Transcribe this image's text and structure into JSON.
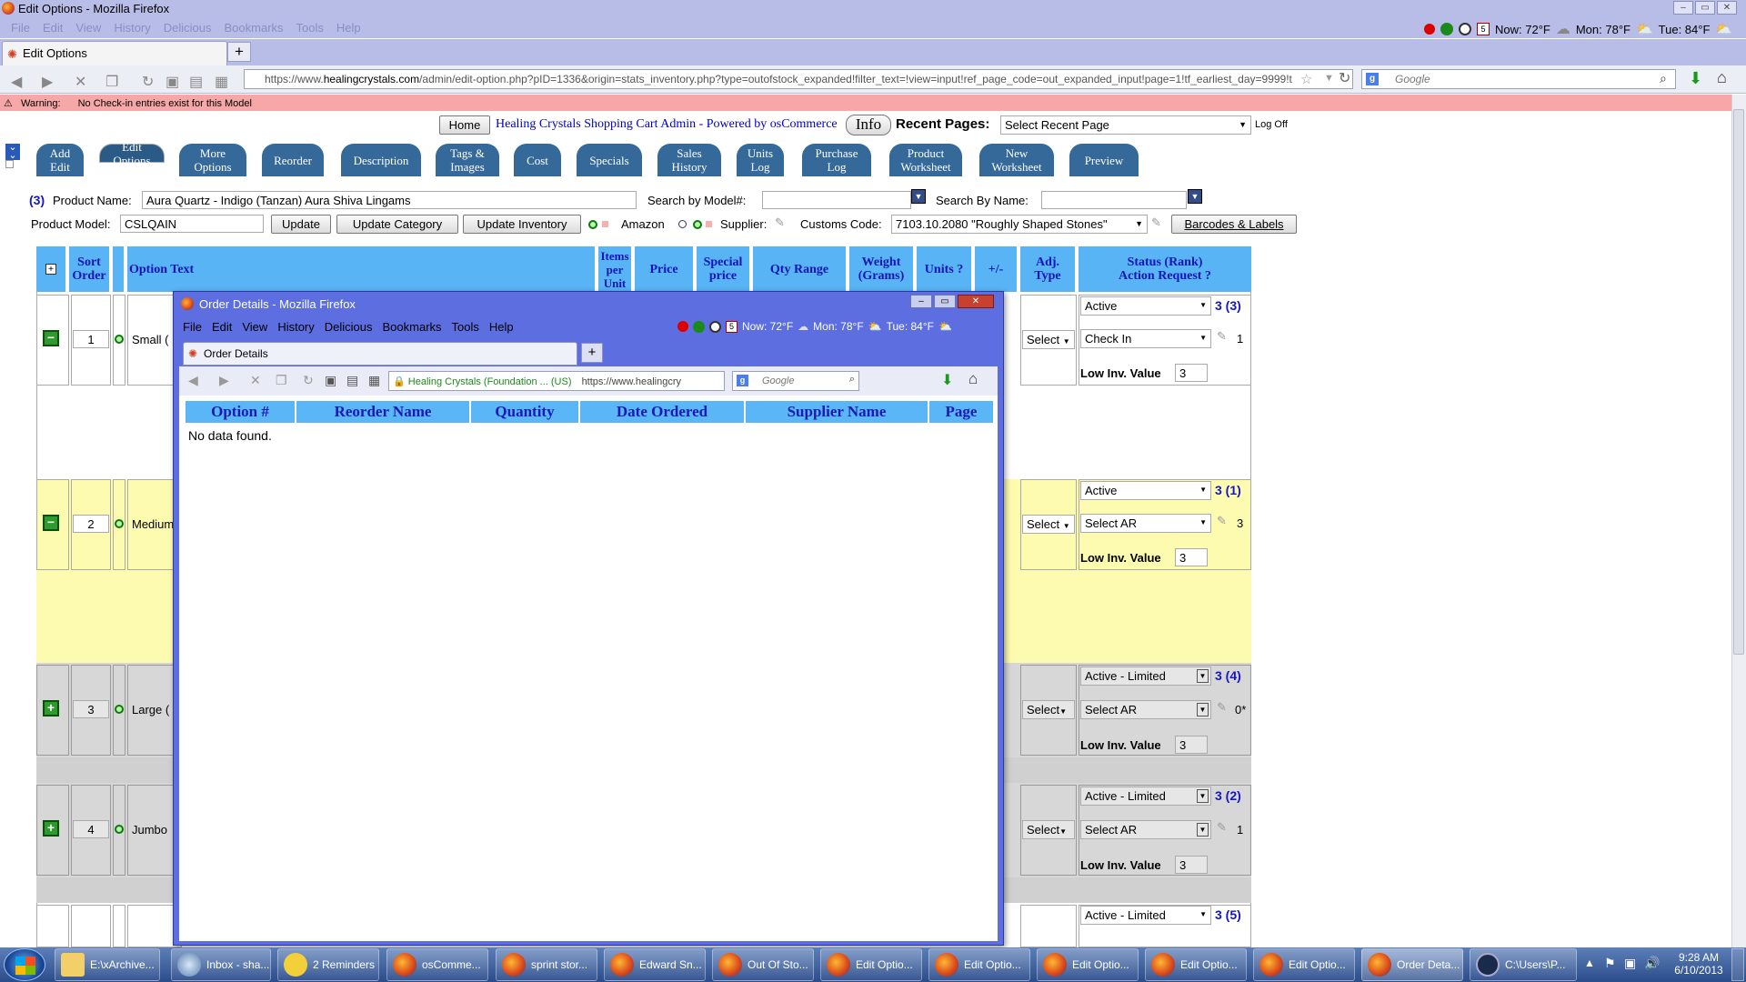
{
  "window": {
    "title": "Edit Options - Mozilla Firefox"
  },
  "menu": [
    "File",
    "Edit",
    "View",
    "History",
    "Delicious",
    "Bookmarks",
    "Tools",
    "Help"
  ],
  "weather": {
    "now": "Now: 72°F",
    "mon": "Mon: 78°F",
    "tue": "Tue: 84°F",
    "cal_day": "5"
  },
  "tabs": [
    {
      "label": "Edit Options"
    }
  ],
  "url": {
    "prefix": "https://www.",
    "host": "healingcrystals.com",
    "path": "/admin/edit-option.php?pID=1336&origin=stats_inventory.php?type=outofstock_expanded!filter_text=!view=input!ref_page_code=out_expanded_input!page=1!tf_earliest_day=9999!t"
  },
  "search_placeholder": "Google",
  "warning": {
    "label": "Warning:",
    "text": "No Check-in entries exist for this Model"
  },
  "header": {
    "home": "Home",
    "brand": "Healing Crystals Shopping Cart Admin - Powered by osCommerce",
    "info": "Info",
    "recent_label": "Recent Pages:",
    "recent_value": "Select Recent Page",
    "logoff": "Log Off"
  },
  "nav_tabs": [
    {
      "label": "Add\nEdit"
    },
    {
      "label": "Edit\nOptions"
    },
    {
      "label": "More\nOptions"
    },
    {
      "label": "Reorder"
    },
    {
      "label": "Description"
    },
    {
      "label": "Tags &\nImages"
    },
    {
      "label": "Cost"
    },
    {
      "label": "Specials"
    },
    {
      "label": "Sales\nHistory"
    },
    {
      "label": "Units\nLog"
    },
    {
      "label": "Purchase\nLog"
    },
    {
      "label": "Product\nWorksheet"
    },
    {
      "label": "New\nWorksheet"
    },
    {
      "label": "Preview"
    }
  ],
  "product": {
    "count": "(3)",
    "name_label": "Product Name:",
    "name": "Aura Quartz - Indigo (Tanzan) Aura Shiva Lingams",
    "search_model_label": "Search by Model#:",
    "search_name_label": "Search By Name:",
    "model_label": "Product Model:",
    "model": "CSLQAIN",
    "update": "Update",
    "update_category": "Update Category",
    "update_inventory": "Update Inventory",
    "amazon": "Amazon",
    "supplier": "Supplier:",
    "customs_label": "Customs Code:",
    "customs_value": "7103.10.2080 \"Roughly Shaped Stones\"",
    "barcodes": "Barcodes & Labels"
  },
  "table": {
    "headers": {
      "expand": "+",
      "sort": "Sort\nOrder",
      "option": "Option Text",
      "items": "Items\nper\nUnit",
      "price": "Price",
      "special": "Special\nprice",
      "qty": "Qty Range",
      "weight": "Weight\n(Grams)",
      "units": "Units ?",
      "plusminus": "+/-",
      "adj": "Adj.\nType",
      "status": "Status (Rank)\nAction Request ?"
    },
    "rows": [
      {
        "sort": "1",
        "option": "Small (",
        "adj": "Select",
        "status": "Active",
        "rank": "3 (3)",
        "action": "Check In",
        "action_count": "1",
        "low_label": "Low Inv. Value",
        "low": "3",
        "toggle": "−"
      },
      {
        "sort": "2",
        "option": "Medium",
        "adj": "Select",
        "status": "Active",
        "rank": "3 (1)",
        "action": "Select AR",
        "action_count": "3",
        "low_label": "Low Inv. Value",
        "low": "3",
        "toggle": "−"
      },
      {
        "sort": "3",
        "option": "Large (",
        "adj": "Select",
        "status": "Active - Limited",
        "rank": "3 (4)",
        "action": "Select AR",
        "action_count": "0*",
        "low_label": "Low Inv. Value",
        "low": "3",
        "toggle": "+"
      },
      {
        "sort": "4",
        "option": "Jumbo",
        "adj": "Select",
        "status": "Active - Limited",
        "rank": "3 (2)",
        "action": "Select AR",
        "action_count": "1",
        "low_label": "Low Inv. Value",
        "low": "3",
        "toggle": "+"
      },
      {
        "status": "Active - Limited",
        "rank": "3 (5)"
      }
    ]
  },
  "popup": {
    "title": "Order Details - Mozilla Firefox",
    "tab": "Order Details",
    "identity": "Healing Crystals (Foundation ... (US)",
    "url": "https://www.healingcry",
    "search_placeholder": "Google",
    "columns": [
      "Option #",
      "Reorder Name",
      "Quantity",
      "Date Ordered",
      "Supplier Name",
      "Page"
    ],
    "empty": "No data found."
  },
  "taskbar": {
    "items": [
      {
        "label": "E:\\xArchive..."
      },
      {
        "label": "Inbox - sha..."
      },
      {
        "label": "2 Reminders"
      },
      {
        "label": "osComme..."
      },
      {
        "label": "sprint stor..."
      },
      {
        "label": "Edward Sn..."
      },
      {
        "label": "Out Of Sto..."
      },
      {
        "label": "Edit Optio..."
      },
      {
        "label": "Edit Optio..."
      },
      {
        "label": "Edit Optio..."
      },
      {
        "label": "Edit Optio..."
      },
      {
        "label": "Edit Optio..."
      },
      {
        "label": "Order Deta..."
      },
      {
        "label": "C:\\Users\\P..."
      }
    ],
    "time": "9:28 AM",
    "date": "6/10/2013"
  }
}
